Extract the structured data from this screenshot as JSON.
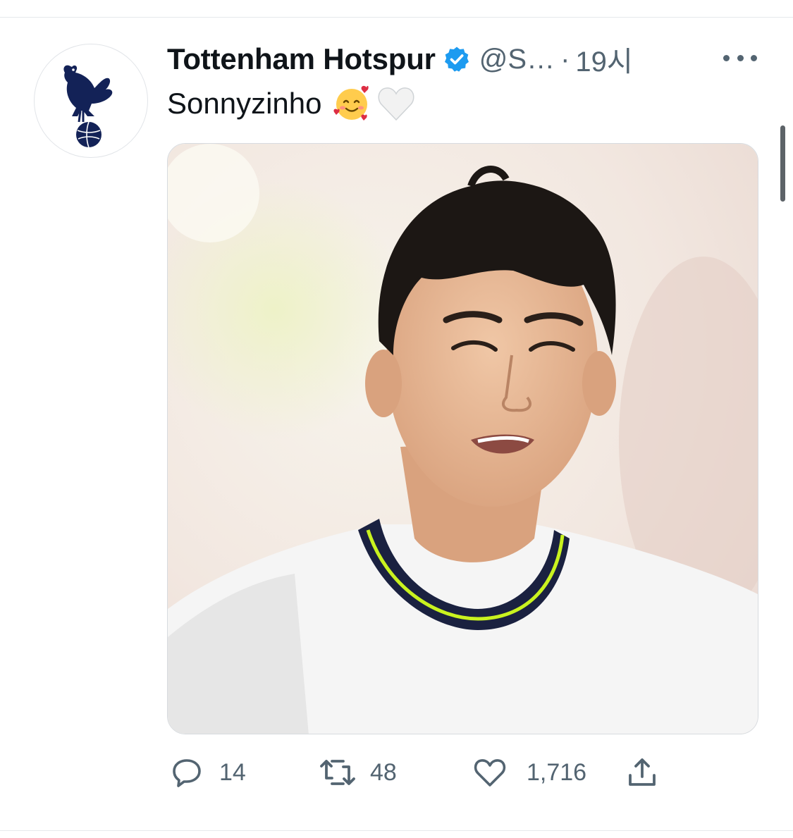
{
  "tweet": {
    "author_name": "Tottenham Hotspur",
    "handle": "@S…",
    "separator": "·",
    "time": "19시",
    "text": "Sonnyzinho",
    "emojis": [
      "smiling-face-with-hearts",
      "white-heart"
    ],
    "avatar_icon": "tottenham-cockerel-logo",
    "media_description": "player-portrait-photo"
  },
  "actions": {
    "reply_count": "14",
    "retweet_count": "48",
    "like_count": "1,716"
  },
  "colors": {
    "verified_blue": "#1d9bf0",
    "text_secondary": "#536471",
    "spurs_navy": "#132257"
  }
}
